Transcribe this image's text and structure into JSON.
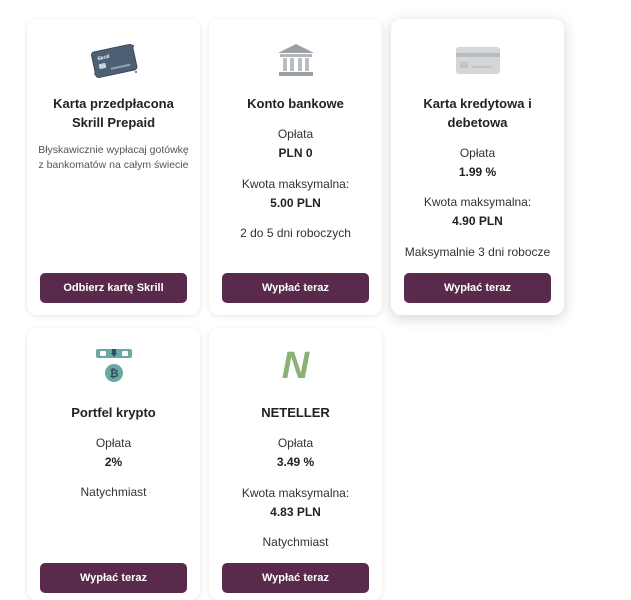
{
  "cards": [
    {
      "icon": "skrill-card-icon",
      "title": "Karta przedpłacona Skrill Prepaid",
      "description": "Błyskawicznie wypłacaj gotówkę z bankomatów na całym świecie",
      "button": "Odbierz kartę Skrill"
    },
    {
      "icon": "bank-icon",
      "title": "Konto bankowe",
      "fee_label": "Opłata",
      "fee_value": "PLN 0",
      "max_label": "Kwota maksymalna:",
      "max_value": "5.00 PLN",
      "time": "2 do 5 dni roboczych",
      "button": "Wypłać teraz"
    },
    {
      "icon": "credit-card-icon",
      "title_line1": "Karta kredytowa i",
      "title_line2": "debetowa",
      "fee_label": "Opłata",
      "fee_value": "1.99 %",
      "max_label": "Kwota maksymalna:",
      "max_value": "4.90 PLN",
      "time": "Maksymalnie 3 dni robocze",
      "button": "Wypłać teraz"
    },
    {
      "icon": "crypto-wallet-icon",
      "title": "Portfel krypto",
      "fee_label": "Opłata",
      "fee_value": "2%",
      "time": "Natychmiast",
      "button": "Wypłać teraz"
    },
    {
      "icon": "neteller-logo-icon",
      "logo_text": "N",
      "title": "NETELLER",
      "fee_label": "Opłata",
      "fee_value": "3.49 %",
      "max_label": "Kwota maksymalna:",
      "max_value": "4.83 PLN",
      "time": "Natychmiast",
      "button": "Wypłać teraz"
    }
  ],
  "colors": {
    "button_bg": "#5a2a4d",
    "neteller_green": "#8bb174",
    "crypto_teal": "#6aa8a4"
  }
}
